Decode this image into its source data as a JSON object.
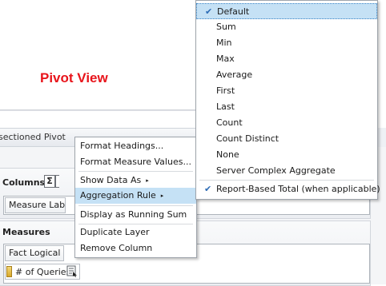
{
  "view": {
    "title": "Pivot View",
    "layout_header": "sectioned Pivot"
  },
  "layout": {
    "columns_label": "Columns",
    "sigma_symbol": "Σ",
    "columns_chip": "Measure Labels",
    "measures_label": "Measures",
    "fact_chip": "Fact Logical Queries",
    "measure_item": "# of Queries"
  },
  "context_menu": {
    "items": [
      {
        "label": "Format Headings..."
      },
      {
        "label": "Format Measure Values..."
      },
      {
        "label": "Show Data As",
        "submenu_glyph": "▸"
      },
      {
        "label": "Aggregation Rule",
        "submenu_glyph": "▸"
      },
      {
        "label": "Display as Running Sum"
      },
      {
        "label": "Duplicate Layer"
      },
      {
        "label": "Remove Column"
      }
    ]
  },
  "aggregation_menu": {
    "check_glyph": "✔",
    "items": [
      {
        "label": "Default",
        "checked": true
      },
      {
        "label": "Sum"
      },
      {
        "label": "Min"
      },
      {
        "label": "Max"
      },
      {
        "label": "Average"
      },
      {
        "label": "First"
      },
      {
        "label": "Last"
      },
      {
        "label": "Count"
      },
      {
        "label": "Count Distinct"
      },
      {
        "label": "None"
      },
      {
        "label": "Server Complex Aggregate"
      },
      {
        "label": "Report-Based Total (when applicable)",
        "checked": true
      }
    ]
  },
  "colors": {
    "title_red": "#e8141b",
    "menu_highlight": "#c5e1f5",
    "check_blue": "#2c6bb5"
  },
  "icons": {
    "sigma": "sigma-icon",
    "measure_bar": "measure-icon",
    "chip_menu": "properties-icon",
    "check": "checkmark-icon",
    "submenu_arrow": "submenu-arrow-icon"
  }
}
